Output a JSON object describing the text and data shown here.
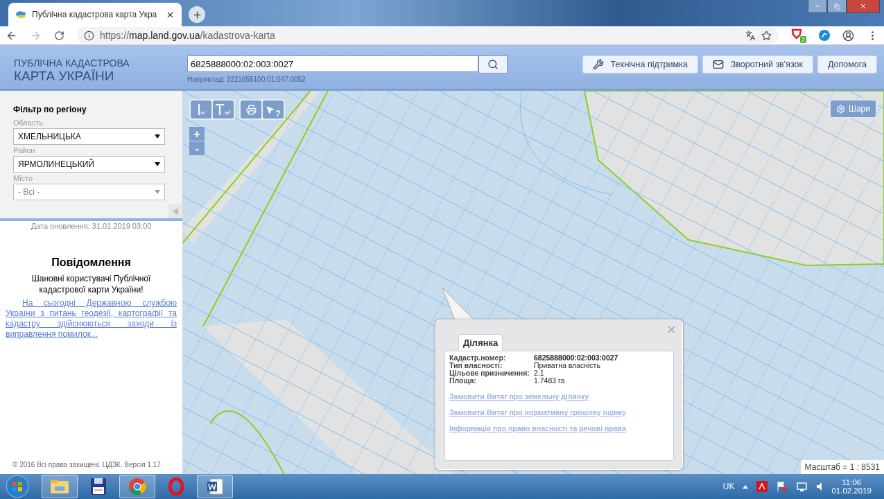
{
  "browser": {
    "tab_title": "Публічна кадастрова карта Укра",
    "url_scheme": "https://",
    "url_host": "map.land.gov.ua",
    "url_path": "/kadastrova-karta",
    "extension_badge": "2"
  },
  "header": {
    "logo_line1": "ПУБЛІЧНА КАДАСТРОВА",
    "logo_line2": "КАРТА УКРАЇНИ",
    "search_value": "6825888000:02:003:0027",
    "search_example": "Наприклад: 3221655100:01:047:0052",
    "buttons": [
      {
        "kind": "support",
        "label": "Технічна підтримка"
      },
      {
        "kind": "feedback",
        "label": "Зворотний зв'язок"
      },
      {
        "kind": "help",
        "label": "Допомога"
      }
    ]
  },
  "sidebar": {
    "filter_title": "Фільтр по регіону",
    "selects": [
      {
        "label": "Область",
        "value": "ХМЕЛЬНИЦЬКА",
        "disabled": false
      },
      {
        "label": "Район",
        "value": "ЯРМОЛИНЕЦЬКИЙ",
        "disabled": false
      },
      {
        "label": "Місто",
        "value": "- Всі -",
        "disabled": true
      }
    ],
    "update_date": "Дата оновлення: 31.01.2019 03:00",
    "notice_title": "Повідомлення",
    "notice_greeting": "Шановні користувачі Публічної кадастрової карти України!",
    "notice_link": "На сьогодні Державною службою України з питань геодезії, картографії та кадастру здійснюються заходи із виправлення помилок...",
    "copyright": "© 2016 Всі права захищені. ЦДЗК. Версія 1.17."
  },
  "map": {
    "tools": [
      {
        "kind": "distance",
        "label": "м"
      },
      {
        "kind": "area",
        "label": "м²"
      },
      {
        "kind": "print"
      },
      {
        "kind": "identify",
        "label": "?"
      }
    ],
    "zoom_in": "+",
    "zoom_out": "-",
    "layers_button": "Шари",
    "scale": "Масштаб = 1 : 8531",
    "popup": {
      "tabs": [
        {
          "label": "Ділянка",
          "selected": true
        }
      ],
      "fields": [
        {
          "label": "Кадастр.номер:",
          "value": "6825888000:02:003:0027",
          "bold": true
        },
        {
          "label": "Тип власності:",
          "value": "Приватна власність",
          "bold": false
        },
        {
          "label": "Цільове призначення:",
          "value": "2.1",
          "bold": false
        },
        {
          "label": "Площа:",
          "value": "1.7483 га",
          "bold": false
        }
      ],
      "links": [
        "Замовити Витяг про земельну ділянку",
        "Замовити Витяг про нормативну грошову оцінку",
        "Інформація про право власності та речові права"
      ]
    }
  },
  "taskbar": {
    "apps": [
      {
        "kind": "folder",
        "running": true
      },
      {
        "kind": "floppy",
        "running": false
      },
      {
        "kind": "chrome",
        "running": true
      },
      {
        "kind": "opera",
        "running": false
      },
      {
        "kind": "word",
        "running": true
      }
    ],
    "language": "UK",
    "time": "11:06",
    "date": "01.02.2019"
  }
}
